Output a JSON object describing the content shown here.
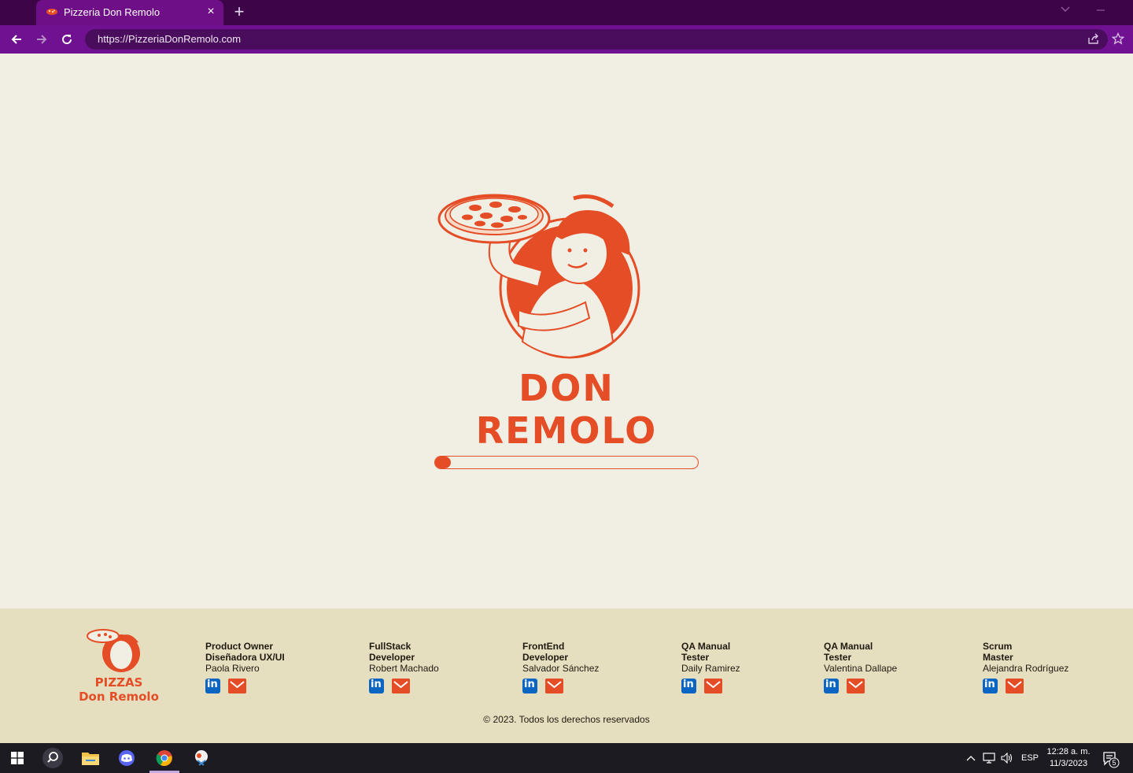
{
  "browser": {
    "tab_title": "Pizzeria Don Remolo",
    "tab_close": "×",
    "new_tab": "+",
    "url": "https://PizzeriaDonRemolo.com",
    "accent": "#701191",
    "tabbar_color": "#3d0548"
  },
  "hero": {
    "brand": "DON REMOLO",
    "loading_progress": 0.06,
    "brand_color": "#e44d26"
  },
  "footer": {
    "logo_line1": "PIZZAS",
    "logo_line2": "Don Remolo",
    "members": [
      {
        "role1": "Product Owner",
        "role2": "Diseñadora UX/UI",
        "name": "Paola Rivero"
      },
      {
        "role1": "FullStack",
        "role2": "Developer",
        "name": "Robert Machado"
      },
      {
        "role1": "FrontEnd",
        "role2": "Developer",
        "name": "Salvador Sánchez"
      },
      {
        "role1": "QA Manual",
        "role2": "Tester",
        "name": "Daily Ramirez"
      },
      {
        "role1": "QA Manual",
        "role2": "Tester",
        "name": "Valentina Dallape"
      },
      {
        "role1": "Scrum",
        "role2": "Master",
        "name": "Alejandra Rodríguez"
      }
    ],
    "linkedin_glyph": "in",
    "copyright": "© 2023. Todos los derechos reservados"
  },
  "taskbar": {
    "language": "ESP",
    "time": "12:28 a. m.",
    "date": "11/3/2023",
    "notification_count": "5",
    "apps": [
      "windows-start-icon",
      "search-icon",
      "file-explorer-icon",
      "discord-icon",
      "chrome-icon",
      "snipping-tool-icon"
    ]
  }
}
